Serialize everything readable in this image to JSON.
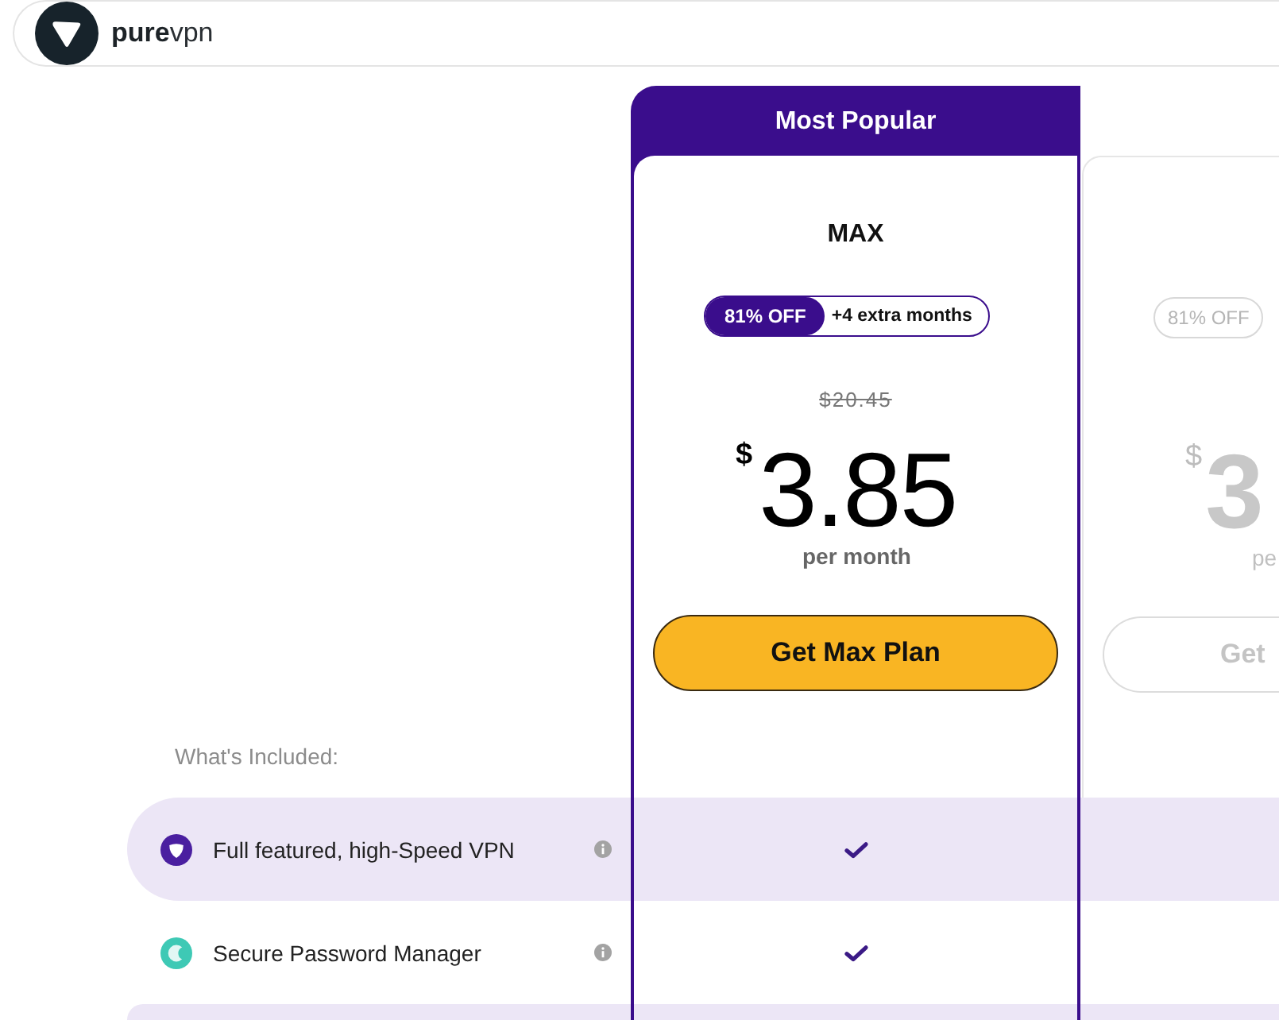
{
  "header": {
    "logo_text": "**pure**vpn"
  },
  "plans": [
    {
      "kind": "featured",
      "ribbon": "Most Popular",
      "name": "MAX",
      "discount": "81% OFF",
      "bonus": "+4 extra months",
      "old_price": "$20.45",
      "currency": "$",
      "price": "3.85",
      "period": "per month",
      "button": "Get Max Plan"
    },
    {
      "kind": "muted",
      "discount": "81% OFF",
      "currency": "$",
      "price": "3",
      "period": "pe",
      "button": "Get"
    }
  ],
  "features": {
    "heading": "What's Included:",
    "rows": [
      {
        "label": "Full featured, high-Speed VPN",
        "color": "#4a1fa0",
        "highlighted": true,
        "included": true
      },
      {
        "label": "Secure Password Manager",
        "color": "#3ec9b5",
        "highlighted": false,
        "included": true
      }
    ]
  }
}
